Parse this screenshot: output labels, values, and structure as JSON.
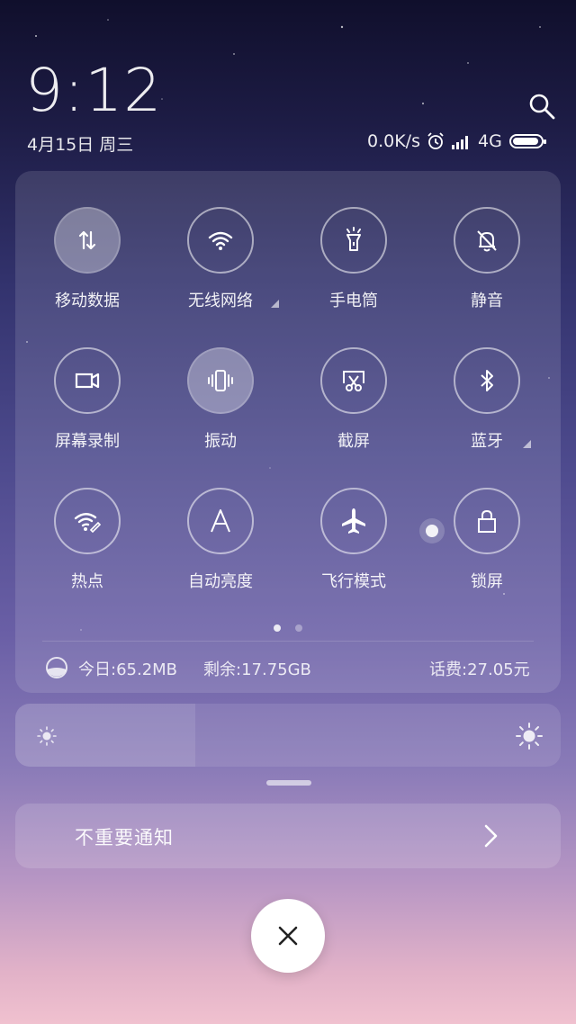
{
  "clock": {
    "time": "9:12",
    "date": "4月15日 周三"
  },
  "status_bar": {
    "net_speed": "0.0K/s",
    "network": "4G"
  },
  "toggles": [
    {
      "label": "移动数据",
      "icon": "mobile-data-icon",
      "on": true
    },
    {
      "label": "无线网络",
      "icon": "wifi-icon",
      "on": false
    },
    {
      "label": "手电筒",
      "icon": "flashlight-icon",
      "on": false
    },
    {
      "label": "静音",
      "icon": "silent-icon",
      "on": false
    },
    {
      "label": "屏幕录制",
      "icon": "screen-record-icon",
      "on": false
    },
    {
      "label": "振动",
      "icon": "vibrate-icon",
      "on": true
    },
    {
      "label": "截屏",
      "icon": "screenshot-icon",
      "on": false
    },
    {
      "label": "蓝牙",
      "icon": "bluetooth-icon",
      "on": false
    },
    {
      "label": "热点",
      "icon": "hotspot-icon",
      "on": false
    },
    {
      "label": "自动亮度",
      "icon": "auto-brightness-icon",
      "on": false
    },
    {
      "label": "飞行模式",
      "icon": "airplane-icon",
      "on": false
    },
    {
      "label": "锁屏",
      "icon": "lock-icon",
      "on": false
    }
  ],
  "pager": {
    "pages": 2,
    "current": 1
  },
  "data_usage": {
    "today": "今日:65.2MB",
    "remaining": "剩余:17.75GB",
    "balance": "话费:27.05元"
  },
  "brightness": {
    "level": 0.33
  },
  "notification": {
    "label": "不重要通知"
  },
  "colors": {
    "panel": "#ffffff1f",
    "close_button": "#ffffff"
  }
}
